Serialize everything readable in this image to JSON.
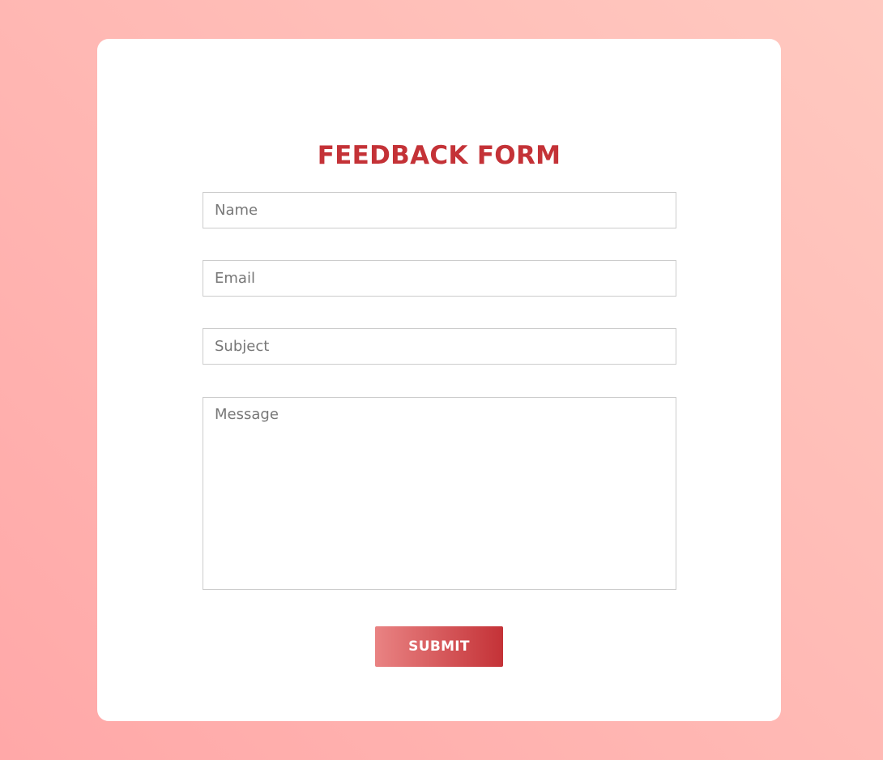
{
  "form": {
    "title": "FEEDBACK FORM",
    "fields": {
      "name": {
        "placeholder": "Name",
        "value": ""
      },
      "email": {
        "placeholder": "Email",
        "value": ""
      },
      "subject": {
        "placeholder": "Subject",
        "value": ""
      },
      "message": {
        "placeholder": "Message",
        "value": ""
      }
    },
    "submit_label": "SUBMIT"
  },
  "colors": {
    "accent": "#c43237",
    "button_gradient_start": "#e98383",
    "button_gradient_end": "#c43237",
    "background_gradient_start": "#ffa8a8",
    "background_gradient_end": "#ffc9c0",
    "card": "#ffffff",
    "field_border": "#cccccc",
    "placeholder": "#777777"
  }
}
